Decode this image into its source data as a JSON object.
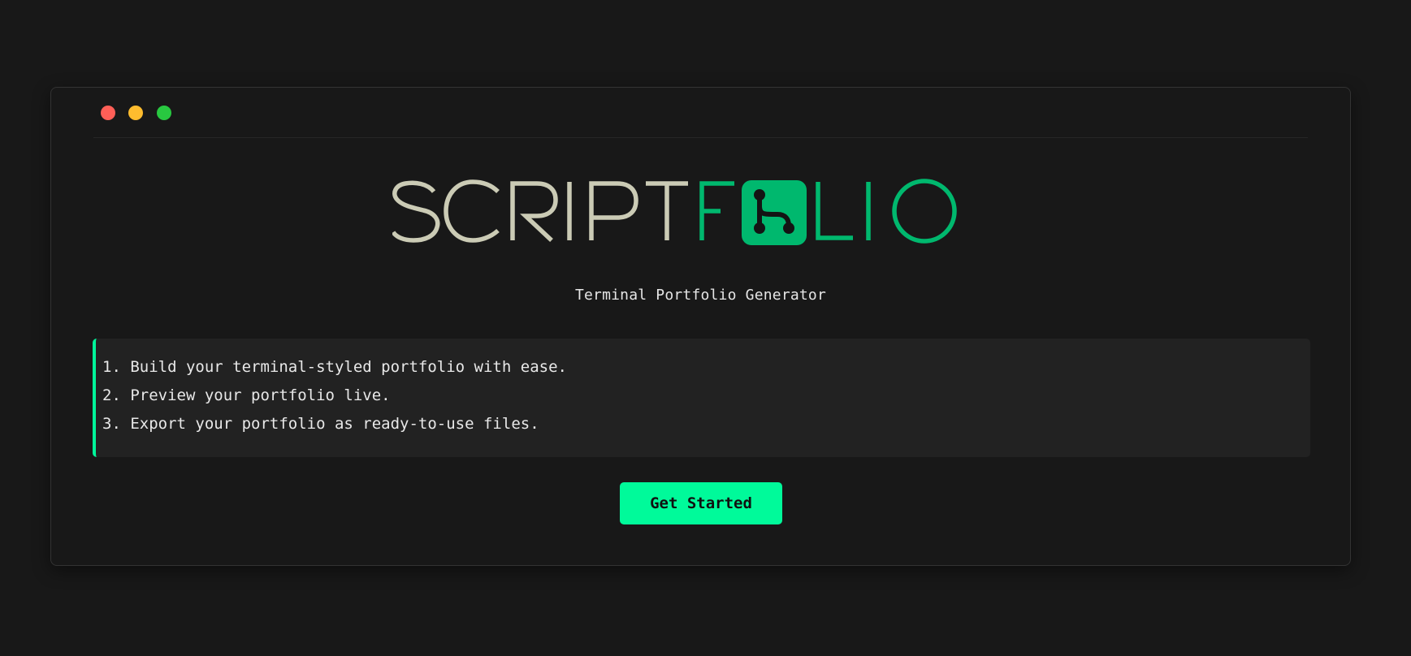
{
  "window": {
    "controls": [
      {
        "name": "close",
        "color": "#ff5f57"
      },
      {
        "name": "minimize",
        "color": "#febc2e"
      },
      {
        "name": "maximize",
        "color": "#28c840"
      }
    ]
  },
  "logo": {
    "text": "SCRIPTFOLIO",
    "text_primary": "SCRIPT",
    "text_accent": "FOLIO",
    "primary_color": "#cbcbb5",
    "accent_color": "#00b86e",
    "icon": "git-branch-icon"
  },
  "subtitle": "Terminal Portfolio Generator",
  "steps": [
    "1. Build your terminal-styled portfolio with ease.",
    "2. Preview your portfolio live.",
    "3. Export your portfolio as ready-to-use files."
  ],
  "cta": {
    "label": "Get Started",
    "color": "#00fa9a"
  }
}
